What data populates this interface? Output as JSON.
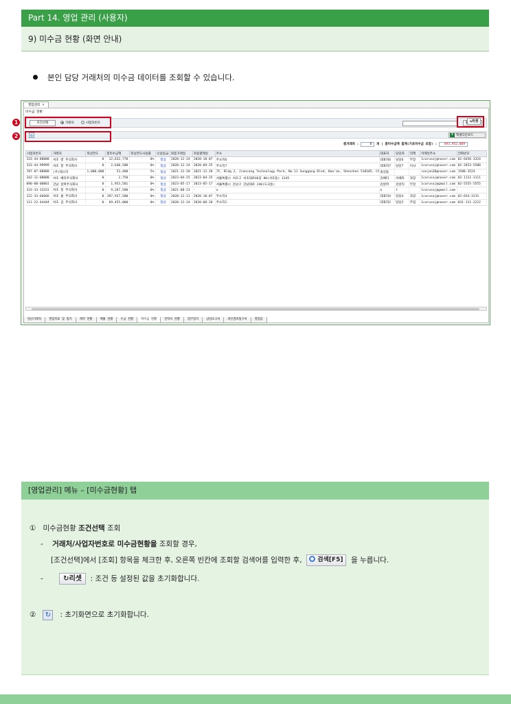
{
  "header": {
    "part": "Part 14. 영업 관리 (사용자)",
    "section": "9) 미수금 현황 (화면 안내)"
  },
  "intro": "본인 담당 거래처의 미수금 데이터를 조회할 수 있습니다.",
  "screen": {
    "top_tab": "영업관리 ×",
    "panel_title": "미수금 현황",
    "filter": {
      "cond_button": "조건선택",
      "radio_1": "거래처",
      "radio_2": "사업자번호",
      "search_btn": "검색[F5]",
      "reset_btn": "리셋"
    },
    "excel_btn": "엑셀다운로드",
    "summary": {
      "count_label": "총거래처 :",
      "count_value": "8",
      "count_unit": "개",
      "total_label": "총미수금액 합계(기초미수금 포함) :",
      "total_value": "493,952,009"
    },
    "columns": [
      "사업자번호",
      "거래처",
      "외상한도",
      "총미수금액",
      "외상한도사용률",
      "신용등급",
      "최종거래일",
      "최종결제일",
      "주소",
      "대표자",
      "담당자",
      "직책",
      "이메일주소",
      "전화번호"
    ],
    "rows": [
      [
        "333-44-88888",
        "서초 병 주식회사",
        "0",
        "12,632,778",
        "0%",
        "정상",
        "2020-12-24",
        "2020-10-07",
        "주소지6",
        "대표자6",
        "담당6",
        "부장",
        "1carusoj@naver.com",
        "02-6456-3324"
      ],
      [
        "333-44-99999",
        "서초 정 주식회사",
        "0",
        "2,640,500",
        "0%",
        "정상",
        "2020-12-24",
        "2020-09-25",
        "주소지7",
        "대표자7",
        "담당7",
        "이사",
        "1carusoj@naver.com",
        "02-2653-5588"
      ],
      [
        "787-87-88888",
        "(주)테스터",
        "1,000,000",
        "53,400",
        "5%",
        "정상",
        "2021-12-28",
        "2021-12-28",
        "7F, Bldg 2, Jiancang Technology Park, No.11 Songgang Blvd, Bao'an, Shenzhen 518105, China",
        "홍길동",
        "",
        "",
        "conjan20@naver.com",
        "1588-3524"
      ],
      [
        "342-11-00000",
        "서초 베타주식회사",
        "0",
        "2,750",
        "0%",
        "정상",
        "2023-04-25",
        "2023-04-25",
        "서울특별시 서초구 서초대로46길 80(서초동) 1245",
        "김베타",
        "이베타",
        "과장",
        "1carusoj@naver.com",
        "02-1111-1111"
      ],
      [
        "090-00-00001",
        "강남 알파주식회사",
        "0",
        "1,953,501",
        "0%",
        "정상",
        "2023-05-17",
        "2023-05-17",
        "서울특별시 강남구 강남대로 240(도곡동)",
        "김알파",
        "김알리",
        "부장",
        "1carusoj@gmail.com",
        "02-5555-5555"
      ],
      [
        "333-33-33331",
        "서초 정 주식회사",
        "0",
        "9,267,500",
        "0%",
        "정상",
        "2021-08-23",
        "-",
        "o",
        "o",
        "t",
        "",
        "1carusoj@gmail.com",
        ""
      ],
      [
        "222-33-66666",
        "서초 을 주식회사",
        "0",
        "397,937,500",
        "0%",
        "정상",
        "2020-12-21",
        "2020-10-07",
        "주소지4",
        "대표자4",
        "담당4",
        "과장",
        "1carusoj@naver.com",
        "02-654-3215"
      ],
      [
        "111-22-44444",
        "서초 갑 주식회사",
        "0",
        "69,455,000",
        "0%",
        "정상",
        "2020-12-24",
        "2020-08-20",
        "주소지2",
        "대표자2",
        "담당2",
        "주임",
        "1carusoj@naver.com",
        "031-111-2222"
      ]
    ],
    "bottom_tabs": [
      "담당거래처",
      "영업목표 및 평가",
      "계약 현황",
      "매출 현황",
      "수금 현황",
      "미수금 현황",
      "견적서 현황",
      "업무일지",
      "상담보고서",
      "개인경비청구서",
      "영업팀"
    ],
    "markers": [
      "1",
      "2"
    ]
  },
  "help": {
    "title": "[영업관리] 메뉴 – [미수금현황] 탭",
    "item1": {
      "num": "①",
      "text_a": "미수금현황 ",
      "text_b": "조건선택",
      "text_c": " 조회",
      "sub1_dash": "-",
      "sub1_bold": "거래처/사업자번호로 미수금현황을",
      "sub1_rest": " 조회할 경우,",
      "sub1_line2_a": "[조건선택]에서 [조회] 항목을 체크한 후, 오른쪽 빈칸에 조회할 검색어를 입력한 후,",
      "sub1_btn": "검색[F5]",
      "sub1_line2_b": "을 누릅니다.",
      "sub2_dash": "-",
      "sub2_btn": "리셋",
      "sub2_text": ": 조건 등 설정된 값을 초기화합니다."
    },
    "item2": {
      "num": "②",
      "text": ": 초기화면으로 초기화합니다."
    }
  }
}
